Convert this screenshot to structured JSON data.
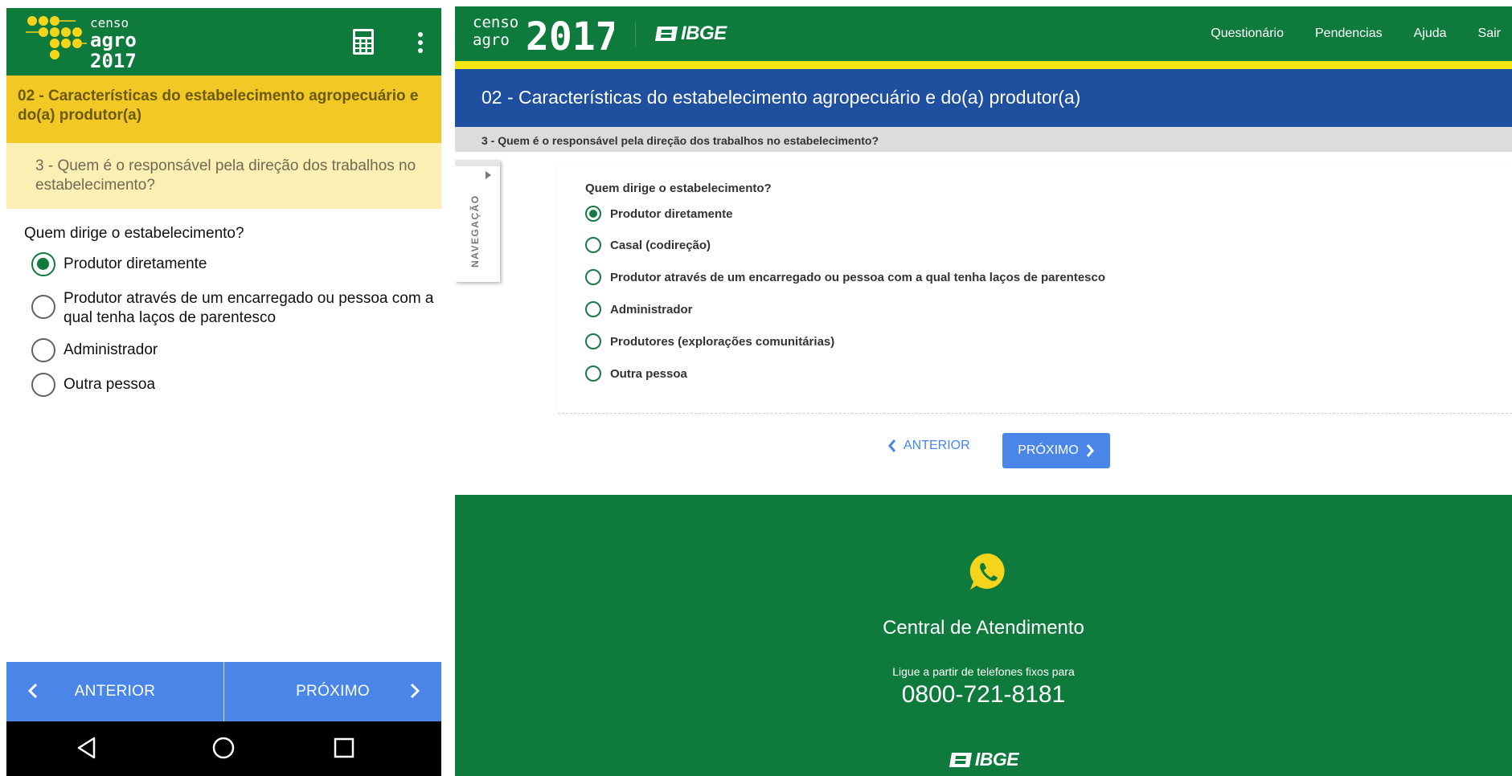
{
  "mobile": {
    "logo": {
      "line1": "censo",
      "line2": "agro",
      "line3": "2017"
    },
    "section_title": "02 - Características do estabelecimento agropecuário e do(a) produtor(a)",
    "question_title": "3 - Quem é o responsável pela direção dos trabalhos no estabelecimento?",
    "ask": "Quem dirige o estabelecimento?",
    "options": [
      {
        "label": "Produtor diretamente",
        "checked": true
      },
      {
        "label": "Produtor através de um encarregado ou pessoa com a qual tenha laços de parentesco",
        "checked": false
      },
      {
        "label": "Administrador",
        "checked": false
      },
      {
        "label": "Outra pessoa",
        "checked": false
      }
    ],
    "prev_label": "ANTERIOR",
    "next_label": "PRÓXIMO"
  },
  "desktop": {
    "logo": {
      "line1": "censo",
      "line2": "agro",
      "year": "2017"
    },
    "brand": "IBGE",
    "menu": [
      "Questionário",
      "Pendencias",
      "Ajuda",
      "Sair"
    ],
    "section_title": "02 - Características do estabelecimento agropecuário e do(a) produtor(a)",
    "question_title": "3 - Quem é o responsável pela direção dos trabalhos no estabelecimento?",
    "nav_tab_label": "NAVEGAÇÃO",
    "ask": "Quem dirige o estabelecimento?",
    "options": [
      {
        "label": "Produtor diretamente",
        "checked": true
      },
      {
        "label": "Casal (codireção)",
        "checked": false
      },
      {
        "label": "Produtor através de um encarregado ou pessoa com a qual tenha laços de parentesco",
        "checked": false
      },
      {
        "label": "Administrador",
        "checked": false
      },
      {
        "label": "Produtores (explorações comunitárias)",
        "checked": false
      },
      {
        "label": "Outra pessoa",
        "checked": false
      }
    ],
    "prev_label": "ANTERIOR",
    "next_label": "PRÓXIMO",
    "footer": {
      "central": "Central de Atendimento",
      "ligue": "Ligue a partir de telefones fixos para",
      "phone": "0800-721-8181",
      "brand": "IBGE"
    }
  },
  "colors": {
    "green": "#0e7a3b",
    "yellow": "#f2c824",
    "blue": "#4a86e8",
    "navy": "#1f4f9f"
  },
  "icons": [
    "calculator-icon",
    "more-vert-icon",
    "chevron-left-icon",
    "chevron-right-icon",
    "back-triangle-icon",
    "home-circle-icon",
    "recents-square-icon",
    "whatsapp-icon",
    "ibge-logo"
  ]
}
